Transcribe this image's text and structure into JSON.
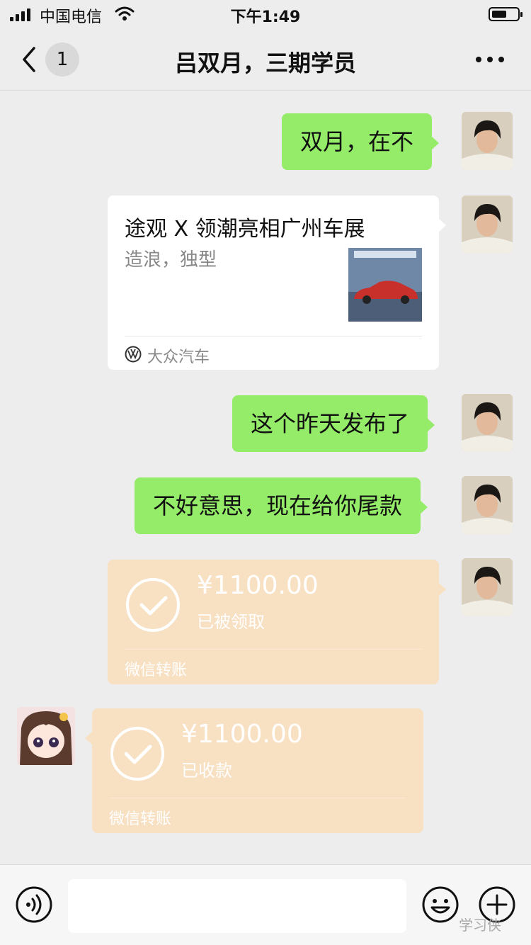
{
  "status_bar": {
    "carrier": "中国电信",
    "time": "下午1:49"
  },
  "nav": {
    "unread_count": "1",
    "title": "吕双月，三期学员"
  },
  "messages": [
    {
      "type": "text",
      "sender": "me",
      "text": "双月，在不"
    },
    {
      "type": "link_card",
      "sender": "me",
      "title": "途观 X 领潮亮相广州车展",
      "description": "造浪，独型",
      "source": "大众汽车"
    },
    {
      "type": "text",
      "sender": "me",
      "text": "这个昨天发布了"
    },
    {
      "type": "text",
      "sender": "me",
      "text": "不好意思，现在给你尾款"
    },
    {
      "type": "transfer",
      "sender": "me",
      "amount": "¥1100.00",
      "status": "已被领取",
      "label": "微信转账"
    },
    {
      "type": "transfer",
      "sender": "peer",
      "amount": "¥1100.00",
      "status": "已收款",
      "label": "微信转账"
    }
  ],
  "input": {
    "placeholder": ""
  },
  "watermark": "学习侠",
  "colors": {
    "my_bubble": "#95ec69",
    "transfer_card": "#f8e0c2",
    "background": "#ededed"
  }
}
